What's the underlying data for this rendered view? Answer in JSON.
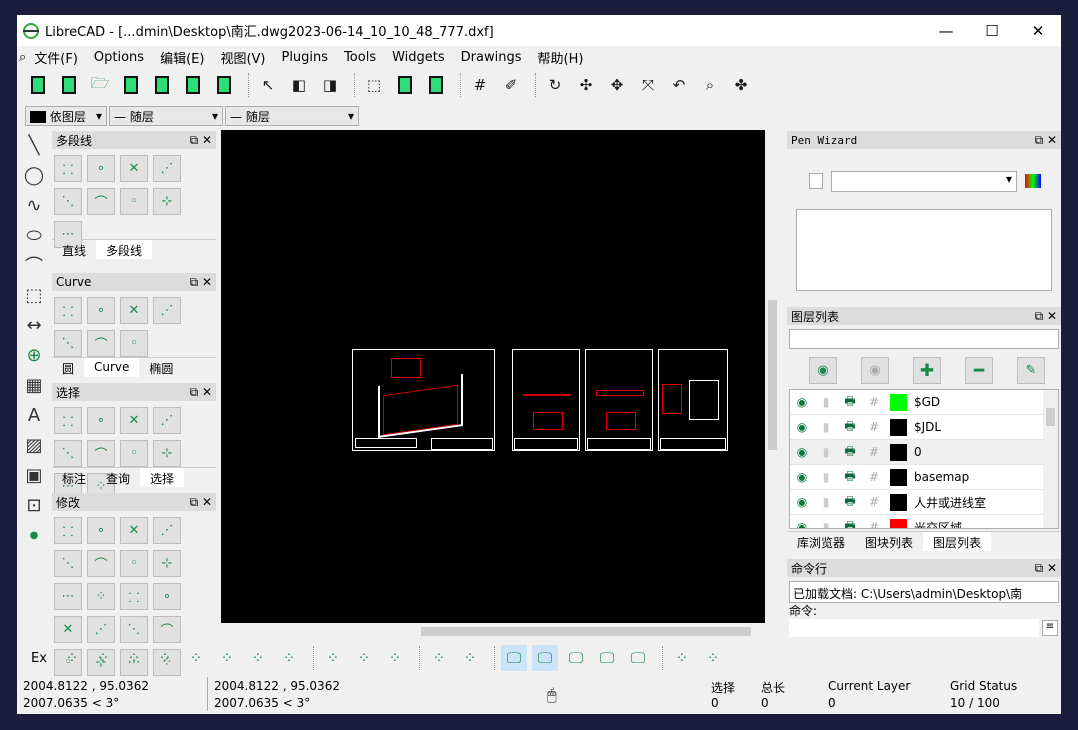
{
  "window": {
    "title": "LibreCAD - [...dmin\\Desktop\\南汇.dwg2023-06-14_10_10_48_777.dxf]",
    "minimize": "—",
    "maximize": "☐",
    "close": "✕"
  },
  "menu": [
    "文件(F)",
    "Options",
    "编辑(E)",
    "视图(V)",
    "Plugins",
    "Tools",
    "Widgets",
    "Drawings",
    "帮助(H)"
  ],
  "pen_toolbar": {
    "color": "依图层",
    "linetype": "随层",
    "width": "随层"
  },
  "docks": {
    "polyline": {
      "title": "多段线",
      "tabs": [
        "直线",
        "多段线"
      ],
      "active_tab": 1,
      "tools": 9
    },
    "curve": {
      "title": "Curve",
      "tabs": [
        "圆",
        "Curve",
        "椭圆"
      ],
      "active_tab": 1,
      "tools": 7
    },
    "select": {
      "title": "选择",
      "tabs": [
        "标注",
        "查询",
        "选择"
      ],
      "active_tab": 2,
      "tools": 10
    },
    "modify": {
      "title": "修改",
      "tools": 20
    }
  },
  "pen_wizard": {
    "title": "Pen Wizard"
  },
  "layer_list": {
    "title": "图层列表",
    "filter": "",
    "layers": [
      {
        "name": "$GD",
        "color": "#00ff00"
      },
      {
        "name": "$JDL",
        "color": "#000000"
      },
      {
        "name": "0",
        "color": "#000000"
      },
      {
        "name": "basemap",
        "color": "#000000"
      },
      {
        "name": "人井或进线室",
        "color": "#000000"
      },
      {
        "name": "光交区域",
        "color": "#ff0000"
      }
    ]
  },
  "right_tabs": [
    "库浏览器",
    "图块列表",
    "图层列表"
  ],
  "command": {
    "title": "命令行",
    "output": "已加载文档: C:\\Users\\admin\\Desktop\\南",
    "prompt": "命令:",
    "input": ""
  },
  "snap_label": "Ex",
  "status": {
    "abs_coord": "2004.8122 , 95.0362",
    "abs_polar": "2007.0635 < 3°",
    "rel_coord": "2004.8122 , 95.0362",
    "rel_polar": "2007.0635 < 3°",
    "select_label": "选择",
    "select_value": "0",
    "total_label": "总长",
    "total_value": "0",
    "layer_label": "Current Layer",
    "layer_value": "0",
    "grid_label": "Grid Status",
    "grid_value": "10 / 100"
  }
}
